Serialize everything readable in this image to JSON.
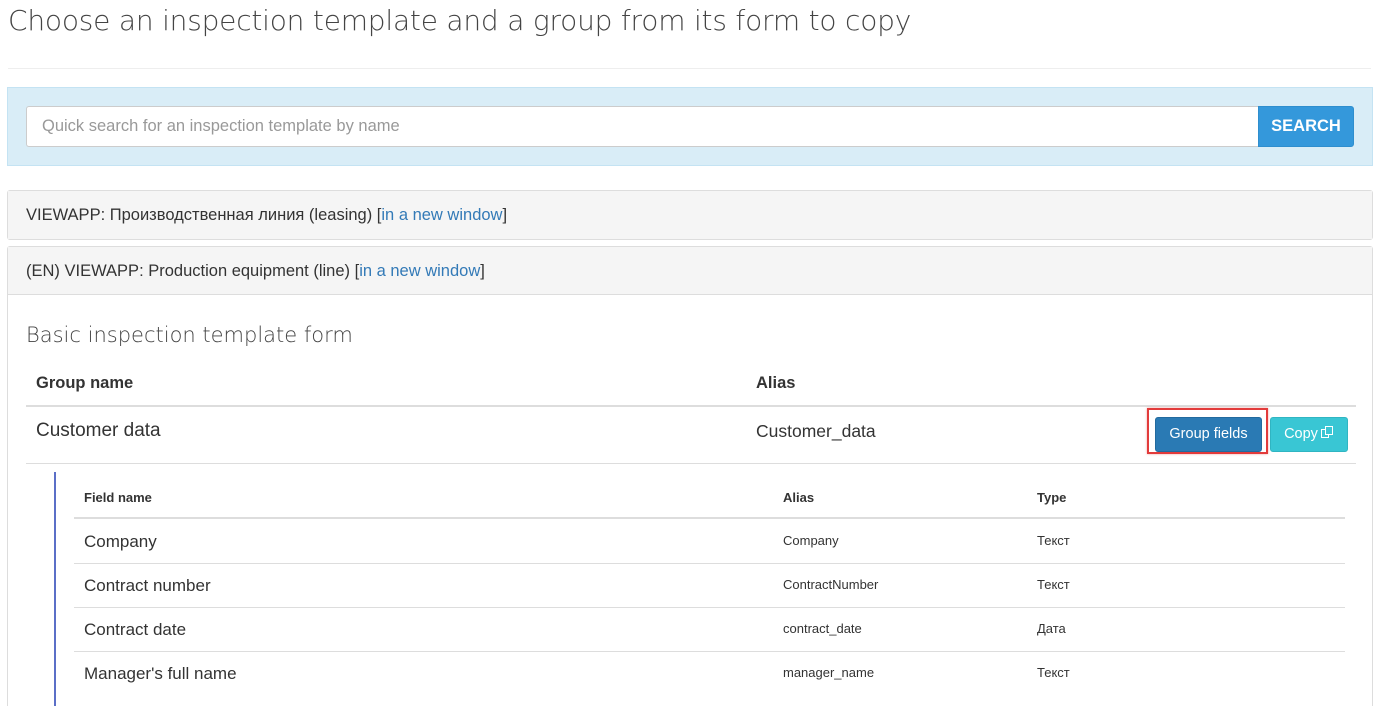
{
  "page": {
    "title": "Choose an inspection template and a group from its form to copy"
  },
  "search": {
    "placeholder": "Quick search for an inspection template by name",
    "button_label": "SEARCH"
  },
  "templates": [
    {
      "name": "VIEWAPP: Производственная линия (leasing)",
      "bracket_open": " [",
      "link_label": "in a new window",
      "bracket_close": "]"
    },
    {
      "name": "(EN) VIEWAPP: Production equipment (line)",
      "bracket_open": " [",
      "link_label": "in a new window",
      "bracket_close": "]"
    }
  ],
  "form": {
    "title": "Basic inspection template form",
    "columns": {
      "group_name": "Group name",
      "alias": "Alias"
    },
    "groups": [
      {
        "name": "Customer data",
        "alias": "Customer_data",
        "group_fields_label": "Group fields",
        "copy_label": "Copy"
      }
    ]
  },
  "fields": {
    "columns": {
      "field_name": "Field name",
      "alias": "Alias",
      "type": "Type"
    },
    "rows": [
      {
        "name": "Company",
        "alias": "Company",
        "type": "Текст"
      },
      {
        "name": "Contract number",
        "alias": "ContractNumber",
        "type": "Текст"
      },
      {
        "name": "Contract date",
        "alias": "contract_date",
        "type": "Дата"
      },
      {
        "name": "Manager's full name",
        "alias": "manager_name",
        "type": "Текст"
      }
    ]
  },
  "colors": {
    "search_button": "#3498db",
    "group_fields_button": "#2a7ab4",
    "copy_button": "#39c6d4",
    "link": "#337ab7",
    "highlight": "#e23b3b",
    "fields_accent": "#5b6fc7"
  }
}
